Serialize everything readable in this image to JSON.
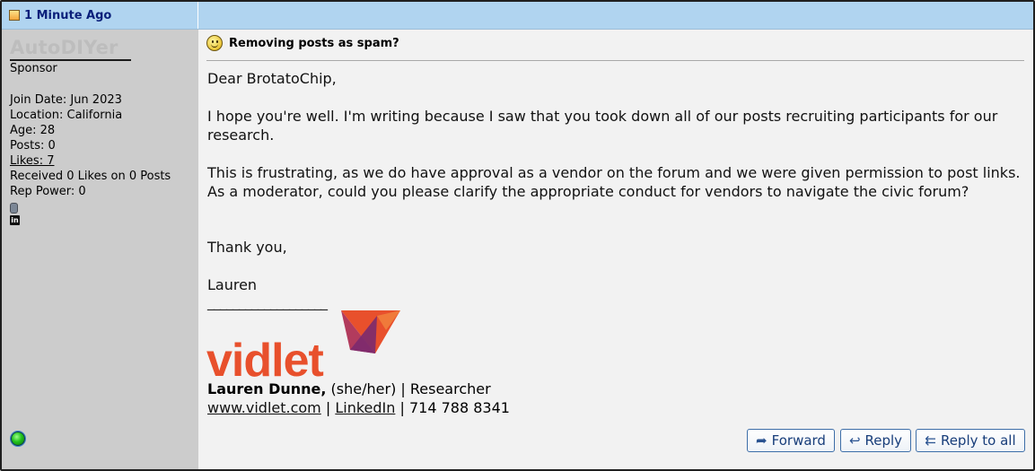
{
  "post": {
    "timestamp": "1 Minute Ago",
    "subject": "Removing posts as spam?"
  },
  "author": {
    "username": "AutoDIYer",
    "title": "Sponsor",
    "join_date": "Join Date: Jun 2023",
    "location": "Location: California",
    "age": "Age: 28",
    "posts": "Posts: 0",
    "likes": "Likes: 7",
    "received": "Received 0 Likes on 0 Posts",
    "rep_power": "Rep Power: 0"
  },
  "message": {
    "greeting": "Dear BrotatoChip,",
    "para1": "I hope you're well. I'm writing because I saw that you took down all of our posts recruiting participants for our research.",
    "para2": "This is frustrating, as we do have approval as a vendor on the forum and we were given permission to post links. As a moderator, could you please clarify the appropriate conduct for vendors to navigate the civic forum?",
    "closing": "Thank you,",
    "signoff": "Lauren",
    "signature_line": "___________________"
  },
  "signature": {
    "logo_text": "vidlet",
    "name": "Lauren Dunne,",
    "role": " (she/her) | Researcher",
    "website": "www.vidlet.com",
    "sep1": " | ",
    "linkedin": "LinkedIn",
    "phone": " | 714 788 8341"
  },
  "buttons": {
    "forward": "Forward",
    "reply": "Reply",
    "reply_all": "Reply to all"
  },
  "colors": {
    "header_bg": "#b0d4f0",
    "sidebar_bg": "#cccccc",
    "content_bg": "#f2f2f2",
    "logo_orange": "#e8502c",
    "logo_purple": "#7b2a6e",
    "button_text": "#173d7a"
  },
  "icons": {
    "post": "post-icon",
    "smiley": "smiley-icon",
    "status": "online-status-icon",
    "linkedin": "linkedin-icon",
    "forward": "forward-arrow-icon",
    "reply": "reply-arrow-icon",
    "reply_all": "reply-all-arrow-icon"
  }
}
